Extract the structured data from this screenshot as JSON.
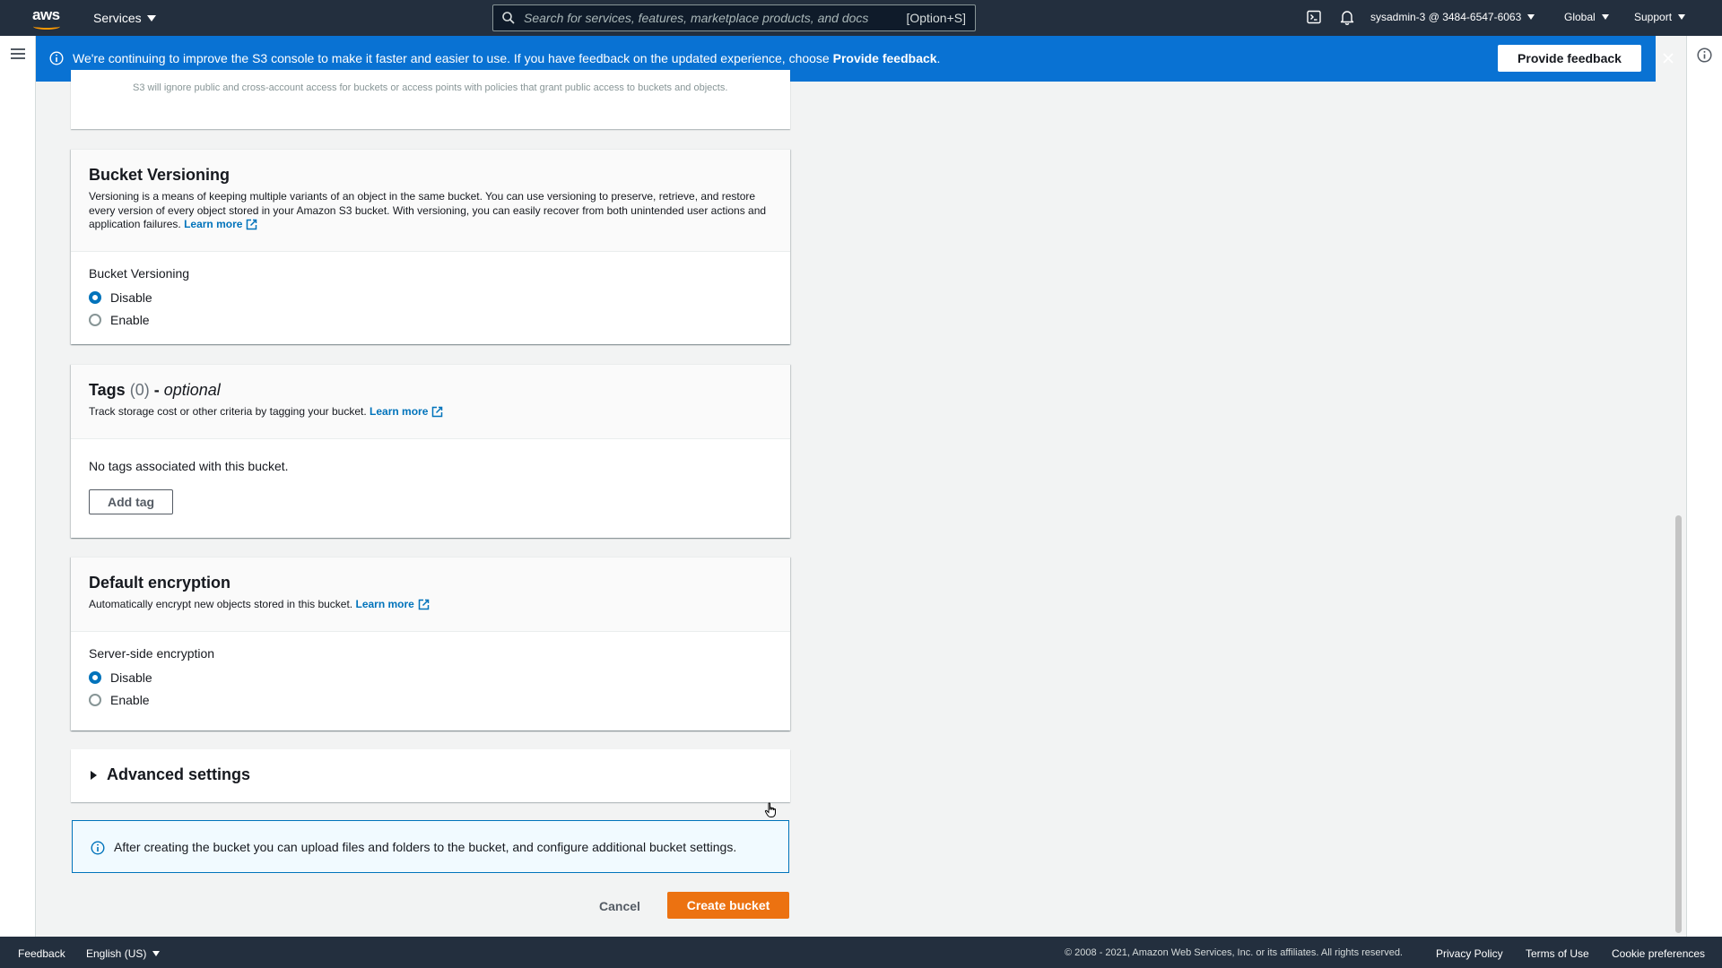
{
  "topnav": {
    "logo_text": "aws",
    "services_label": "Services",
    "search_placeholder": "Search for services, features, marketplace products, and docs",
    "search_shortcut": "[Option+S]",
    "account": "sysadmin-3 @ 3484-6547-6063",
    "region": "Global",
    "support": "Support"
  },
  "banner": {
    "message_prefix": "We're continuing to improve the S3 console to make it faster and easier to use. If you have feedback on the updated experience, choose",
    "message_link": "Provide feedback",
    "message_suffix": ".",
    "button_label": "Provide feedback"
  },
  "block_public_partial": {
    "text": "S3 will ignore public and cross-account access for buckets or access points with policies that grant public access to buckets and objects."
  },
  "versioning": {
    "title": "Bucket Versioning",
    "description": "Versioning is a means of keeping multiple variants of an object in the same bucket. You can use versioning to preserve, retrieve, and restore every version of every object stored in your Amazon S3 bucket. With versioning, you can easily recover from both unintended user actions and application failures.",
    "learn_more": "Learn more",
    "field_label": "Bucket Versioning",
    "options": [
      "Disable",
      "Enable"
    ],
    "selected": "Disable"
  },
  "tags": {
    "title": "Tags",
    "count": "(0)",
    "dash": " - ",
    "optional": "optional",
    "description": "Track storage cost or other criteria by tagging your bucket.",
    "learn_more": "Learn more",
    "empty_text": "No tags associated with this bucket.",
    "add_button": "Add tag"
  },
  "encryption": {
    "title": "Default encryption",
    "description": "Automatically encrypt new objects stored in this bucket.",
    "learn_more": "Learn more",
    "field_label": "Server-side encryption",
    "options": [
      "Disable",
      "Enable"
    ],
    "selected": "Disable"
  },
  "advanced": {
    "label": "Advanced settings"
  },
  "info_box": {
    "text": "After creating the bucket you can upload files and folders to the bucket, and configure additional bucket settings."
  },
  "actions": {
    "cancel": "Cancel",
    "create": "Create bucket"
  },
  "footer": {
    "feedback": "Feedback",
    "language": "English (US)",
    "copyright": "© 2008 - 2021, Amazon Web Services, Inc. or its affiliates. All rights reserved.",
    "privacy": "Privacy Policy",
    "terms": "Terms of Use",
    "cookies": "Cookie preferences"
  },
  "colors": {
    "nav_bg": "#232f3e",
    "banner_bg": "#0972d3",
    "primary_button": "#ec7211",
    "link": "#0073bb",
    "radio_selected": "#0073bb"
  }
}
